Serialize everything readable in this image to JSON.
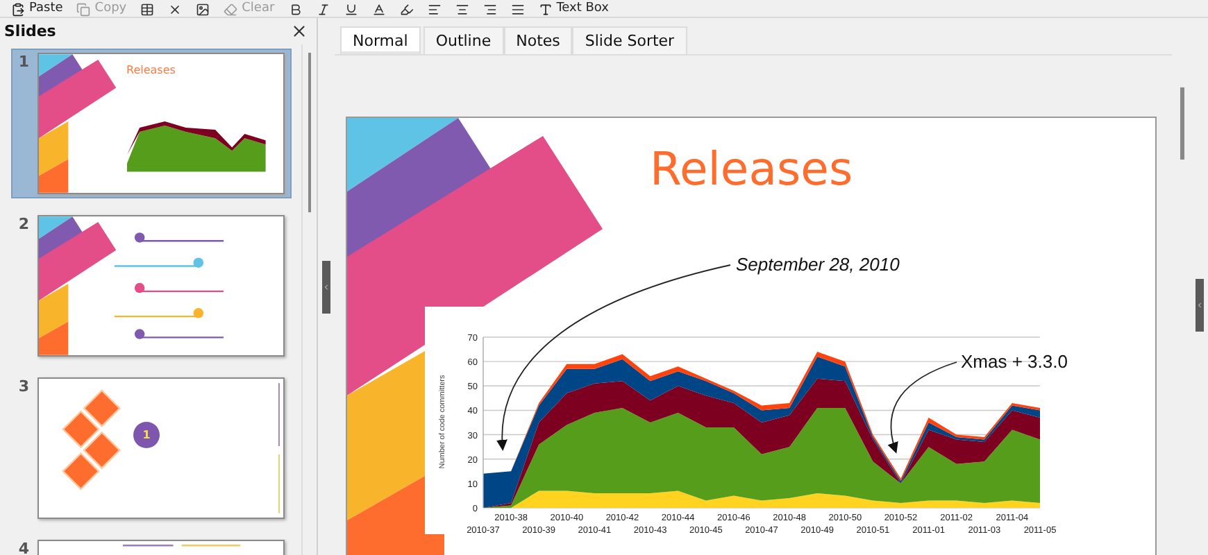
{
  "toolbar": {
    "items": [
      {
        "label": "Paste",
        "disabled": false
      },
      {
        "label": "Copy",
        "disabled": true
      },
      {
        "label": "Clear",
        "disabled": true
      },
      {
        "label": "Text Box",
        "disabled": false
      }
    ]
  },
  "slides_panel": {
    "title": "Slides",
    "slides": [
      {
        "number": "1",
        "selected": true,
        "kind": "chart",
        "title": "Releases"
      },
      {
        "number": "2",
        "selected": false,
        "kind": "timeline"
      },
      {
        "number": "3",
        "selected": false,
        "kind": "diamonds",
        "badge": "1"
      },
      {
        "number": "4",
        "selected": false,
        "kind": "lines"
      }
    ]
  },
  "tabs": [
    {
      "label": "Normal",
      "selected": true
    },
    {
      "label": "Outline",
      "selected": false
    },
    {
      "label": "Notes",
      "selected": false
    },
    {
      "label": "Slide Sorter",
      "selected": false
    }
  ],
  "slide": {
    "title": "Releases",
    "chart_data": {
      "type": "area",
      "stacked": true,
      "ylabel": "Number of code committers",
      "categories": [
        "2010-37",
        "2010-38",
        "2010-39",
        "2010-40",
        "2010-41",
        "2010-42",
        "2010-43",
        "2010-44",
        "2010-45",
        "2010-46",
        "2010-47",
        "2010-48",
        "2010-49",
        "2010-50",
        "2010-51",
        "2010-52",
        "2011-01",
        "2011-02",
        "2011-03",
        "2011-04",
        "2011-05"
      ],
      "ylim": [
        0,
        70
      ],
      "yticks": [
        0,
        10,
        20,
        30,
        40,
        50,
        60,
        70
      ],
      "series": [
        {
          "color": "#ffd320",
          "values": [
            0,
            0,
            7,
            7,
            6,
            6,
            6,
            7,
            3,
            5,
            3,
            4,
            6,
            5,
            3,
            2,
            3,
            3,
            2,
            3,
            2
          ]
        },
        {
          "color": "#579d1c",
          "values": [
            0,
            1,
            19,
            27,
            33,
            35,
            29,
            32,
            30,
            28,
            19,
            21,
            35,
            36,
            16,
            8,
            22,
            15,
            17,
            29,
            26
          ]
        },
        {
          "color": "#7e0021",
          "values": [
            0,
            1,
            9,
            13,
            12,
            11,
            9,
            11,
            13,
            10,
            13,
            13,
            12,
            11,
            9,
            0,
            7,
            10,
            8,
            8,
            9
          ]
        },
        {
          "color": "#004586",
          "values": [
            14,
            13,
            7,
            10,
            6,
            9,
            8,
            6,
            6,
            4,
            5,
            3,
            9,
            6,
            1,
            1,
            3,
            1,
            1,
            2,
            3
          ]
        },
        {
          "color": "#ff420e",
          "values": [
            0,
            0,
            1,
            2,
            2,
            2,
            2,
            2,
            1,
            1,
            2,
            2,
            2,
            2,
            1,
            1,
            2,
            1,
            1,
            1,
            1
          ]
        }
      ],
      "grid": true,
      "annotations": [
        {
          "text": "September 28, 2010"
        },
        {
          "text": "Xmas + 3.3.0"
        }
      ]
    }
  }
}
